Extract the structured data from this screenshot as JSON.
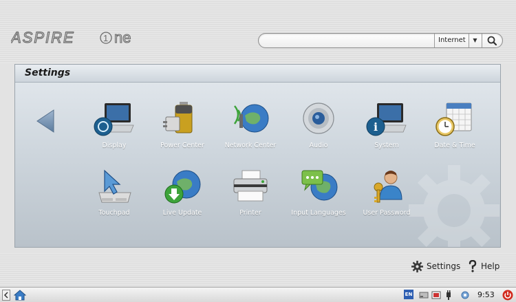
{
  "header": {
    "logo_text": "ASPIRE one",
    "search": {
      "value": "",
      "placeholder": "",
      "engine": "Internet"
    }
  },
  "panel": {
    "title": "Settings",
    "items": [
      {
        "label": "Display",
        "icon": "laptop-display-icon"
      },
      {
        "label": "Power Center",
        "icon": "battery-icon"
      },
      {
        "label": "Network Center",
        "icon": "network-globe-icon"
      },
      {
        "label": "Audio",
        "icon": "speaker-icon"
      },
      {
        "label": "System",
        "icon": "laptop-info-icon"
      },
      {
        "label": "Date & Time",
        "icon": "calendar-clock-icon"
      },
      {
        "label": "Touchpad",
        "icon": "touchpad-icon"
      },
      {
        "label": "Live Update",
        "icon": "globe-download-icon"
      },
      {
        "label": "Printer",
        "icon": "printer-icon"
      },
      {
        "label": "Input Languages",
        "icon": "globe-chat-icon"
      },
      {
        "label": "User Password",
        "icon": "user-key-icon"
      }
    ]
  },
  "footer": {
    "settings_label": "Settings",
    "help_label": "Help"
  },
  "taskbar": {
    "language": "EN",
    "clock": "9:53"
  },
  "colors": {
    "panel_bg": "#cfd7de",
    "accent_blue": "#2e6fb8",
    "power_red": "#d22b1f"
  }
}
